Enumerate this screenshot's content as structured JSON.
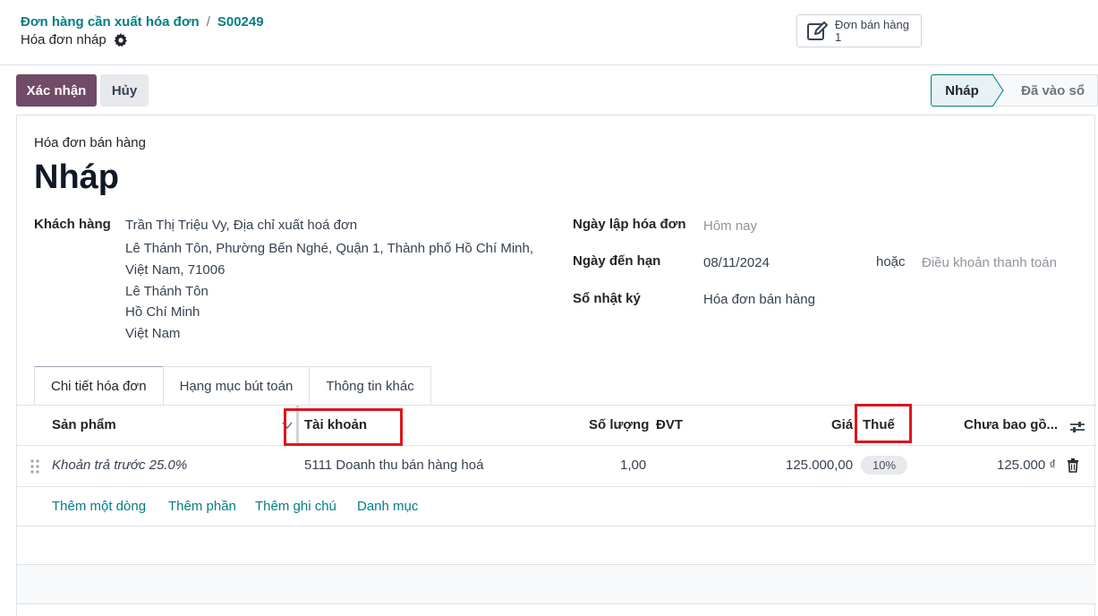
{
  "breadcrumb": {
    "parent": "Đơn hàng cần xuất hóa đơn",
    "separator": "/",
    "current": "S00249"
  },
  "record_subtitle": "Hóa đơn nháp",
  "smart_button": {
    "label": "Đơn bán hàng",
    "count": "1",
    "icon": "edit-icon"
  },
  "actions": {
    "confirm": "Xác nhận",
    "cancel": "Hủy"
  },
  "statusbar": {
    "draft": "Nháp",
    "posted": "Đã vào sổ"
  },
  "form": {
    "doc_type": "Hóa đơn bán hàng",
    "doc_name": "Nháp",
    "customer_label": "Khách hàng",
    "customer_name": "Trần Thị Triệu Vy, Địa chỉ xuất hoá đơn",
    "customer_address": [
      "Lê Thánh Tôn, Phường Bến Nghé, Quận 1, Thành phố Hồ Chí Minh,",
      "Việt Nam, 71006",
      "Lê Thánh Tôn",
      "Hồ Chí Minh",
      "Việt Nam"
    ],
    "invoice_date_label": "Ngày lập hóa đơn",
    "invoice_date_placeholder": "Hôm nay",
    "due_date_label": "Ngày đến hạn",
    "due_date_value": "08/11/2024",
    "or_label": "hoặc",
    "payment_terms_placeholder": "Điều khoản thanh toán",
    "journal_label": "Sổ nhật ký",
    "journal_value": "Hóa đơn bán hàng"
  },
  "tabs": [
    {
      "label": "Chi tiết hóa đơn",
      "active": true
    },
    {
      "label": "Hạng mục bút toán",
      "active": false
    },
    {
      "label": "Thông tin khác",
      "active": false
    }
  ],
  "table": {
    "headers": {
      "product": "Sản phẩm",
      "account": "Tài khoản",
      "quantity": "Số lượng",
      "uom": "ĐVT",
      "price": "Giá",
      "tax": "Thuế",
      "subtotal": "Chưa bao gồ..."
    },
    "rows": [
      {
        "product": "Khoản trả trước 25.0%",
        "account": "5111 Doanh thu bán hàng hoá",
        "quantity": "1,00",
        "price": "125.000,00",
        "tax": "10%",
        "subtotal": "125.000 ₫"
      }
    ],
    "add_links": [
      "Thêm một dòng",
      "Thêm phần",
      "Thêm ghi chú",
      "Danh mục"
    ]
  },
  "colors": {
    "primary": "#714b67",
    "link": "#017e84",
    "highlight": "#e0151c"
  }
}
